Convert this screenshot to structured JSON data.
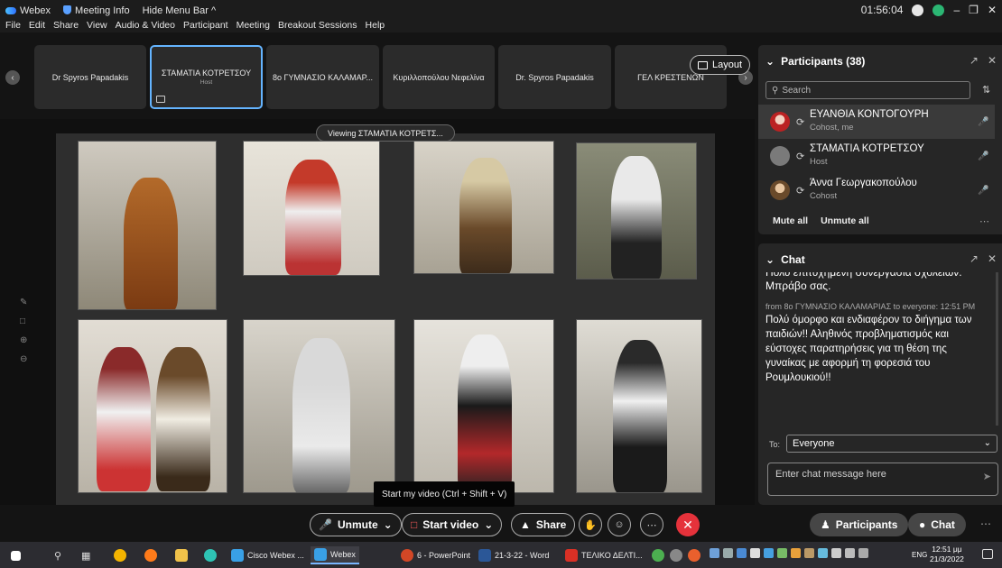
{
  "titlebar": {
    "app": "Webex",
    "meeting_info": "Meeting Info",
    "hide_menu": "Hide Menu Bar ^",
    "time": "01:56:04",
    "menu": [
      "File",
      "Edit",
      "Share",
      "View",
      "Audio & Video",
      "Participant",
      "Meeting",
      "Breakout Sessions",
      "Help"
    ]
  },
  "thumbnails": [
    {
      "name": "Dr Spyros Papadakis",
      "sub": ""
    },
    {
      "name": "ΣΤΑΜΑΤΙΑ ΚΟΤΡΕΤΣΟΥ",
      "sub": "Host"
    },
    {
      "name": "8ο ΓΥΜΝΑΣΙΟ ΚΑΛΑΜΑΡ...",
      "sub": ""
    },
    {
      "name": "Κυριλλοπούλου Νεφελίνα",
      "sub": ""
    },
    {
      "name": "Dr. Spyros Papadakis",
      "sub": ""
    },
    {
      "name": "ΓΕΛ ΚΡΕΣΤΕΝΩΝ",
      "sub": ""
    }
  ],
  "layout_button": "Layout",
  "viewing_label": "Viewing ΣΤΑΜΑΤΙΑ ΚΟΤΡΕΤΣ...",
  "tooltip": "Start my video (Ctrl + Shift + V)",
  "controls": {
    "unmute": "Unmute",
    "start_video": "Start video",
    "share": "Share",
    "participants": "Participants",
    "chat": "Chat"
  },
  "participants_panel": {
    "title": "Participants (38)",
    "search_placeholder": "Search",
    "list": [
      {
        "name": "ΕΥΑΝΘΙΑ ΚΟΝΤΟΓΟΥΡΗ",
        "role": "Cohost, me"
      },
      {
        "name": "ΣΤΑΜΑΤΙΑ ΚΟΤΡΕΤΣΟΥ",
        "role": "Host"
      },
      {
        "name": "Άννα Γεωργακοπούλου",
        "role": "Cohost"
      }
    ],
    "mute_all": "Mute all",
    "unmute_all": "Unmute all"
  },
  "chat_panel": {
    "title": "Chat",
    "cut_text": "Πολύ επιτυχημένη συνεργασία σχολείων. Μπράβο σας.",
    "meta": "from 8ο ΓΥΜΝΑΣΙΟ ΚΑΛΑΜΑΡΙΑΣ to everyone:   12:51 PM",
    "message": "Πολύ όμορφο και ενδιαφέρον το διήγημα των παιδιών!! Αληθινός προβληματισμός και εύστοχες παρατηρήσεις για τη θέση της γυναίκας με αφορμή τη φορεσιά του Ρουμλουκιού!!",
    "to_label": "To:",
    "to_value": "Everyone",
    "input_placeholder": "Enter chat message here"
  },
  "taskbar": {
    "items": [
      "Cisco Webex ...",
      "Webex",
      "6 - PowerPoint",
      "21-3-22 - Word",
      "ΤΕΛΙΚΟ ΔΕΛΤΙ..."
    ],
    "lang": "ENG",
    "time": "12:51 μμ",
    "date": "21/3/2022"
  },
  "colors": {
    "accent": "#64b4ff",
    "leave": "#e5323b",
    "mic_muted": "#ff5b5b"
  }
}
